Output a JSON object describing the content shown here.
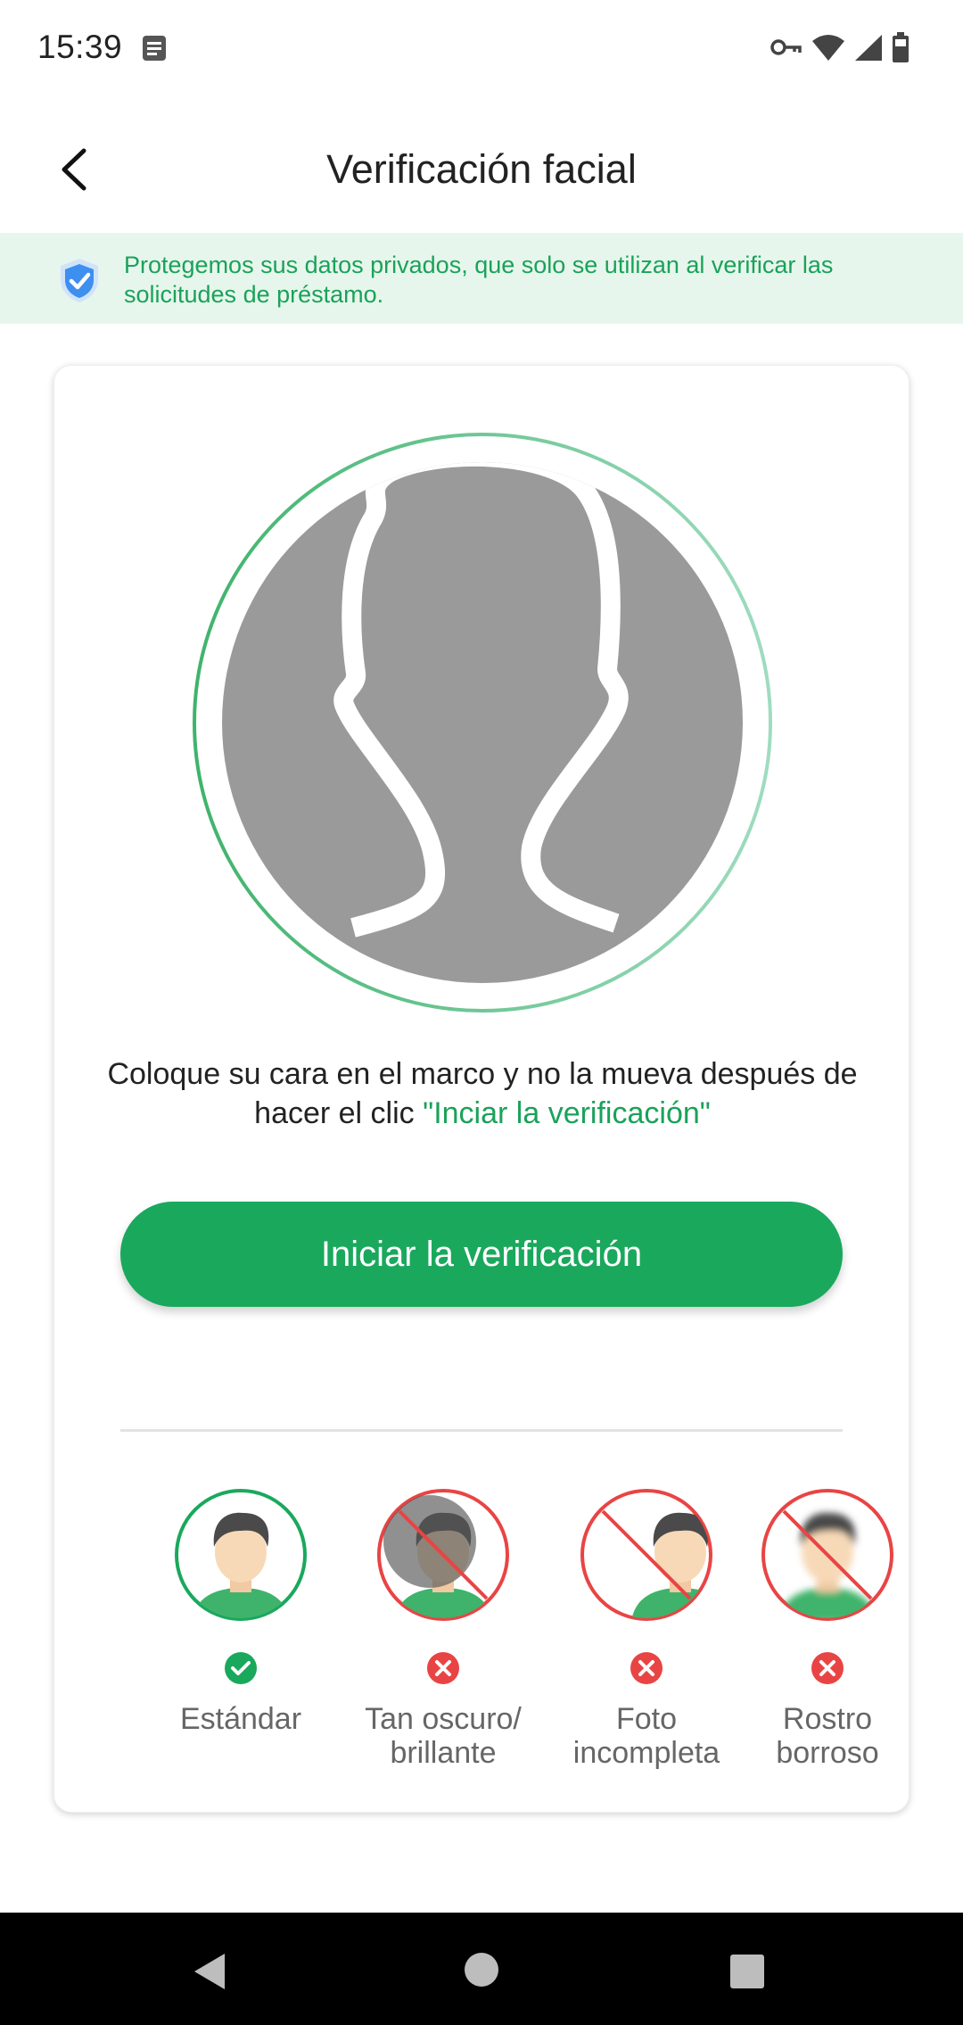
{
  "status": {
    "time": "15:39"
  },
  "header": {
    "title": "Verificación facial"
  },
  "banner": {
    "text": "Protegemos sus datos privados, que solo se utilizan al verificar las solicitudes de préstamo."
  },
  "instruction": {
    "text_before": "Coloque su cara en el marco y no la mueva después de hacer el clic ",
    "highlight": "\"Inciar la verificación\""
  },
  "start_button": {
    "label": "Iniciar la verificación"
  },
  "examples": [
    {
      "line1": "Estándar",
      "line2": "",
      "status": "ok"
    },
    {
      "line1": "Tan oscuro/",
      "line2": "brillante",
      "status": "bad"
    },
    {
      "line1": "Foto",
      "line2": "incompleta",
      "status": "bad"
    },
    {
      "line1": "Rostro",
      "line2": "borroso",
      "status": "bad"
    }
  ],
  "colors": {
    "accent": "#1aa85d",
    "banner_bg": "#e7f6ec",
    "error": "#e94444"
  }
}
